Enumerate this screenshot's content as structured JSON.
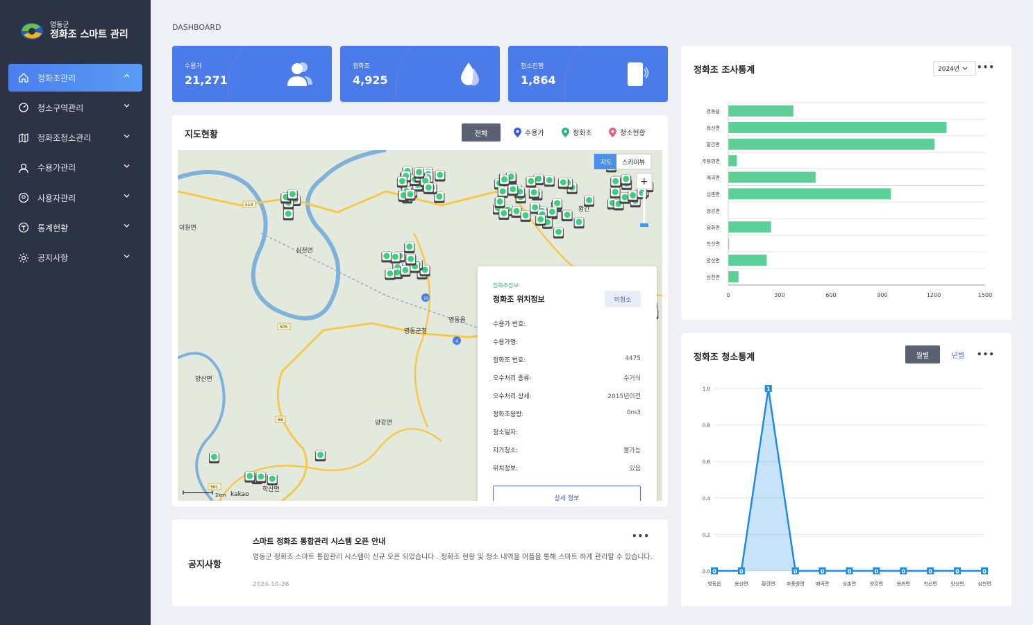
{
  "brand": {
    "region": "영동군",
    "title": "정화조 스마트 관리"
  },
  "nav": [
    {
      "label": "정화조관리",
      "icon": "home-icon",
      "active": true
    },
    {
      "label": "청소구역관리",
      "icon": "gauge-icon"
    },
    {
      "label": "정화조청소관리",
      "icon": "map-icon"
    },
    {
      "label": "수용가관리",
      "icon": "user-icon"
    },
    {
      "label": "사용자관리",
      "icon": "user-circle-icon"
    },
    {
      "label": "통계현황",
      "icon": "stats-icon"
    },
    {
      "label": "공지사항",
      "icon": "settings-icon"
    }
  ],
  "breadcrumb": "DASHBOARD",
  "stats": [
    {
      "label": "수용가",
      "value": "21,271",
      "icon": "users-icon"
    },
    {
      "label": "정화조",
      "value": "4,925",
      "icon": "water-drop-icon"
    },
    {
      "label": "청소진행",
      "value": "1,864",
      "icon": "phone-icon"
    }
  ],
  "map_card": {
    "title": "지도현황",
    "filter_all": "전체",
    "legend": [
      {
        "label": "수용가",
        "color": "#3b5bd6"
      },
      {
        "label": "정화조",
        "color": "#2fb37a"
      },
      {
        "label": "청소현황",
        "color": "#e0607a"
      }
    ],
    "map_type": [
      "지도",
      "스카이뷰"
    ],
    "zoom_in": "+",
    "scale": "2km",
    "provider": "kakao",
    "place_labels": [
      "이원면",
      "심천면",
      "영동읍",
      "영동군청",
      "양산면",
      "양강면",
      "학산면",
      "황간"
    ],
    "road_labels": [
      "514",
      "19",
      "505",
      "4",
      "68",
      "501"
    ]
  },
  "info_popup": {
    "subtitle": "정화조정보",
    "title": "정화조 위치정보",
    "status": "미청소",
    "rows": [
      {
        "k": "수용가 번호:",
        "v": ""
      },
      {
        "k": "수용가명:",
        "v": ""
      },
      {
        "k": "정화조 번호:",
        "v": "4475"
      },
      {
        "k": "오수처리 종류:",
        "v": "수거식"
      },
      {
        "k": "오수처리 상세:",
        "v": "2015년이전"
      },
      {
        "k": "정화조용량:",
        "v": "0m3"
      },
      {
        "k": "청소일자:",
        "v": ""
      },
      {
        "k": "자가청소:",
        "v": "불가능"
      },
      {
        "k": "위치정보:",
        "v": "있음"
      }
    ],
    "detail_button": "상세 정보"
  },
  "notice": {
    "label": "공지사항",
    "title": "스마트 정화조 통합관리 시스템 오픈 안내",
    "body": "영동군 정화조 스마트 통합관리 시스템이 신규 오픈 되었습니다 . 정화조 현황 및 청소 내역을 어플을 통해 스마트 하게 관리할 수 있습니다.",
    "date": "2024-10-28"
  },
  "survey_card": {
    "title": "정화조 조사통계",
    "year": "2024년"
  },
  "clean_card": {
    "title": "정화조 청소통계",
    "tab_monthly": "월별",
    "tab_yearly": "년별"
  },
  "chart_data": [
    {
      "type": "bar",
      "orientation": "horizontal",
      "title": "정화조 조사통계",
      "categories": [
        "영동읍",
        "용산면",
        "황간면",
        "추풍령면",
        "매곡면",
        "상촌면",
        "양강면",
        "용화면",
        "학산면",
        "양산면",
        "심천면"
      ],
      "values": [
        380,
        1275,
        1205,
        50,
        510,
        950,
        0,
        250,
        5,
        225,
        60
      ],
      "xlim": [
        0,
        1500
      ],
      "xticks": [
        0,
        300,
        600,
        900,
        1200,
        1500
      ],
      "color": "#5ccf98"
    },
    {
      "type": "area",
      "title": "정화조 청소통계",
      "categories": [
        "영동읍",
        "용산면",
        "황간면",
        "추풍령면",
        "매곡면",
        "상촌면",
        "양강면",
        "용화면",
        "학산면",
        "양산면",
        "심천면"
      ],
      "values": [
        0,
        0,
        1,
        0,
        0,
        0,
        0,
        0,
        0,
        0,
        0
      ],
      "ylim": [
        0,
        1.0
      ],
      "yticks": [
        "0.0",
        "0.2",
        "0.4",
        "0.6",
        "0.8",
        "1.0"
      ],
      "color": "#1f8ae6"
    }
  ]
}
